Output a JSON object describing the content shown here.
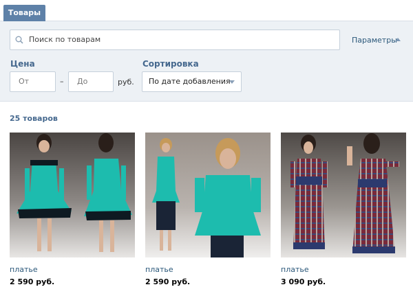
{
  "tabs": {
    "active_label": "Товары"
  },
  "search": {
    "placeholder": "Поиск по товарам"
  },
  "params": {
    "label": "Параметры"
  },
  "price": {
    "label": "Цена",
    "from_placeholder": "От",
    "to_placeholder": "До",
    "dash": "–",
    "unit": "руб."
  },
  "sort": {
    "label": "Сортировка",
    "selected": "По дате добавления"
  },
  "results": {
    "count_label": "25 товаров"
  },
  "products": [
    {
      "category": "платье",
      "price": "2 590 руб.",
      "dress_color": "#19b3a6"
    },
    {
      "category": "платье",
      "price": "2 590 руб.",
      "dress_color": "#19b3a6"
    },
    {
      "category": "платье",
      "price": "3 090 руб.",
      "dress_color": "#7a2a3a"
    }
  ]
}
